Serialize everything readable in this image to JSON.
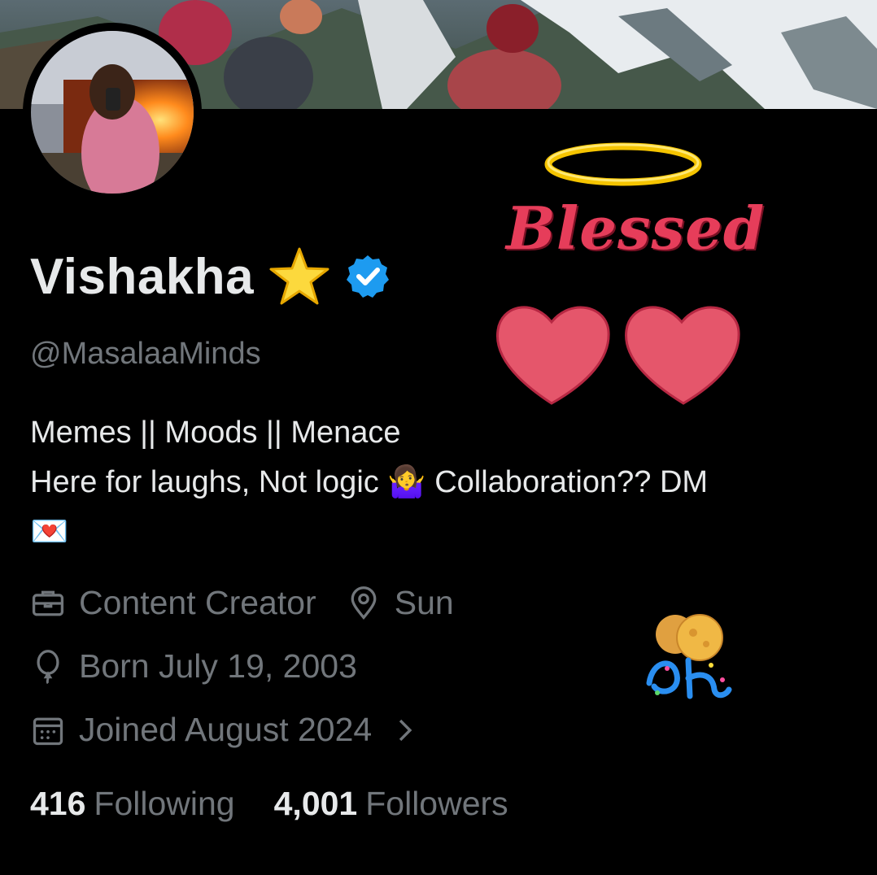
{
  "profile": {
    "display_name": "Vishakha",
    "handle": "@MasalaaMinds",
    "bio_line1": "Memes || Moods || Menace",
    "bio_line2a": "Here for laughs, Not logic ",
    "bio_emoji_shrug": "🤷‍♀️",
    "bio_line2b": "  Collaboration?? DM",
    "bio_emoji_letter": "💌",
    "category": "Content Creator",
    "location": "Sun",
    "birthday": "Born July 19, 2003",
    "joined": "Joined August 2024"
  },
  "stats": {
    "following_count": "416",
    "following_label": "Following",
    "followers_count": "4,001",
    "followers_label": "Followers"
  },
  "decorations": {
    "sticker_text": "Blessed",
    "accent_color": "#1d9bf0",
    "heart_color": "#e5566b",
    "halo_color": "#f5c400"
  },
  "icons": {
    "verified": "verified-badge-icon",
    "star": "star-emoji",
    "category": "briefcase-icon",
    "location": "location-pin-icon",
    "birthday": "balloon-icon",
    "joined": "calendar-icon",
    "chevron": "chevron-right-icon"
  }
}
